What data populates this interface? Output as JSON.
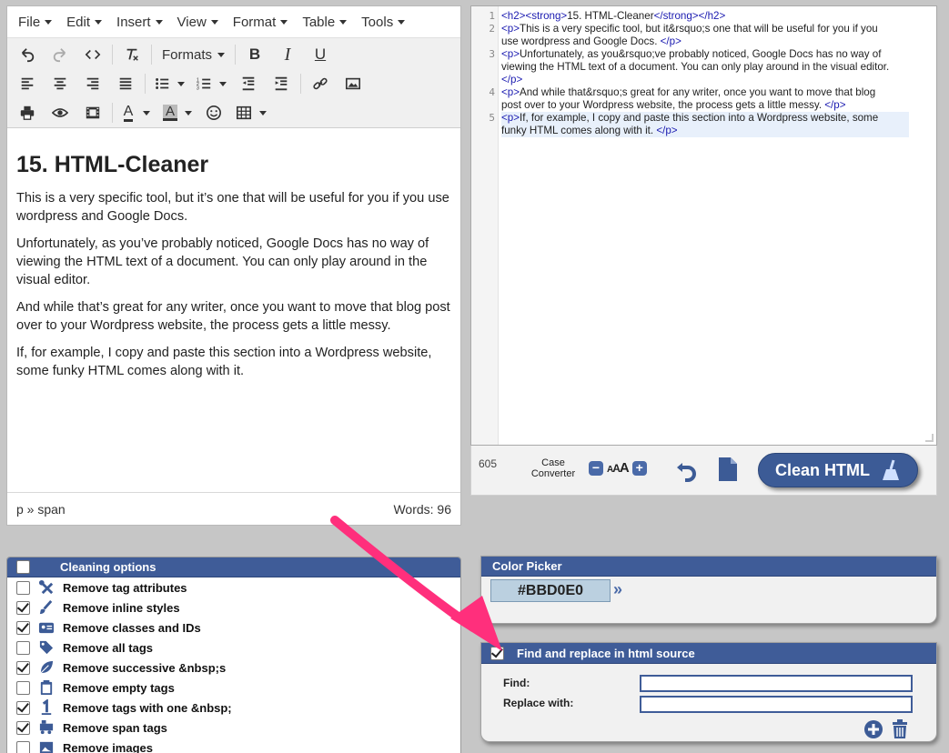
{
  "menubar": [
    "File",
    "Edit",
    "Insert",
    "View",
    "Format",
    "Table",
    "Tools"
  ],
  "toolbar": {
    "formats_label": "Formats",
    "bold": "B",
    "italic": "I",
    "underline": "U",
    "text_color_letter": "A",
    "bg_color_letter": "A"
  },
  "editor": {
    "heading": "15. HTML-Cleaner",
    "paragraphs": [
      "This is a very specific tool, but it’s one that will be useful for you if you use wordpress and Google Docs.",
      "Unfortunately, as you’ve probably noticed, Google Docs has no way of viewing the HTML text of a document. You can only play around in the visual editor.",
      "And while that’s great for any writer, once you want to move that blog post over to your Wordpress website, the process gets a little messy.",
      "If, for example, I copy and paste this section into a Wordpress website, some funky HTML comes along with it."
    ],
    "path": "p » span",
    "words": "Words: 96"
  },
  "source": {
    "lines": [
      {
        "num": "1",
        "rows": [
          [
            {
              "t": "tag",
              "v": "<h2>"
            },
            {
              "t": "tag",
              "v": "<strong>"
            },
            {
              "t": "txt",
              "v": "15. HTML-Cleaner"
            },
            {
              "t": "tag",
              "v": "</strong>"
            },
            {
              "t": "tag",
              "v": "</h2>"
            }
          ]
        ]
      },
      {
        "num": "2",
        "rows": [
          [
            {
              "t": "tag",
              "v": "<p>"
            },
            {
              "t": "txt",
              "v": "This is a very specific tool, but it&rsquo;s one that will be useful for you if you"
            }
          ],
          [
            {
              "t": "txt",
              "v": "use wordpress and Google Docs. "
            },
            {
              "t": "tag",
              "v": "</p>"
            }
          ]
        ]
      },
      {
        "num": "3",
        "rows": [
          [
            {
              "t": "tag",
              "v": "<p>"
            },
            {
              "t": "txt",
              "v": "Unfortunately, as you&rsquo;ve probably noticed, Google Docs has no way of"
            }
          ],
          [
            {
              "t": "txt",
              "v": "viewing the HTML text of a document. You can only play around in the visual editor."
            }
          ],
          [
            {
              "t": "tag",
              "v": "</p>"
            }
          ]
        ]
      },
      {
        "num": "4",
        "rows": [
          [
            {
              "t": "tag",
              "v": "<p>"
            },
            {
              "t": "txt",
              "v": "And while that&rsquo;s great for any writer, once you want to move that blog"
            }
          ],
          [
            {
              "t": "txt",
              "v": "post over to your Wordpress website, the process gets a little messy. "
            },
            {
              "t": "tag",
              "v": "</p>"
            }
          ]
        ]
      },
      {
        "num": "5",
        "rows": [
          [
            {
              "t": "tag",
              "v": "<p>"
            },
            {
              "t": "txt",
              "v": "If, for example, I copy and paste this section into a Wordpress website, some"
            }
          ],
          [
            {
              "t": "txt",
              "v": "funky HTML comes along with it. "
            },
            {
              "t": "tag",
              "v": "</p>"
            }
          ]
        ]
      }
    ]
  },
  "actionbar": {
    "char_count": "605",
    "case_converter_label": "Case Converter",
    "case_sizes": "AAA",
    "clean_button": "Clean HTML"
  },
  "cleaning_options": {
    "title": "Cleaning options",
    "header_checked": false,
    "items": [
      {
        "label": "Remove tag attributes",
        "checked": false,
        "icon": "tools-icon"
      },
      {
        "label": "Remove inline styles",
        "checked": true,
        "icon": "brush-icon"
      },
      {
        "label": "Remove classes and IDs",
        "checked": true,
        "icon": "id-card-icon"
      },
      {
        "label": "Remove all tags",
        "checked": false,
        "icon": "tag-icon"
      },
      {
        "label": "Remove successive &nbsp;s",
        "checked": true,
        "icon": "leaf-icon"
      },
      {
        "label": "Remove empty tags",
        "checked": false,
        "icon": "clipboard-icon"
      },
      {
        "label": "Remove tags with one &nbsp;",
        "checked": true,
        "icon": "number-one-icon"
      },
      {
        "label": "Remove span tags",
        "checked": true,
        "icon": "train-icon"
      },
      {
        "label": "Remove images",
        "checked": false,
        "icon": "image-icon"
      }
    ]
  },
  "color_picker": {
    "title": "Color Picker",
    "hex": "#BBD0E0",
    "swatch_color": "#BBD0E0"
  },
  "find_replace": {
    "title": "Find and replace in html source",
    "checked": true,
    "find_label": "Find:",
    "replace_label": "Replace with:",
    "find_value": "",
    "replace_value": ""
  },
  "colors": {
    "panel_header": "#3f5c98",
    "clean_button": "#3c5b96",
    "annotation_arrow": "#ff2f7c"
  }
}
